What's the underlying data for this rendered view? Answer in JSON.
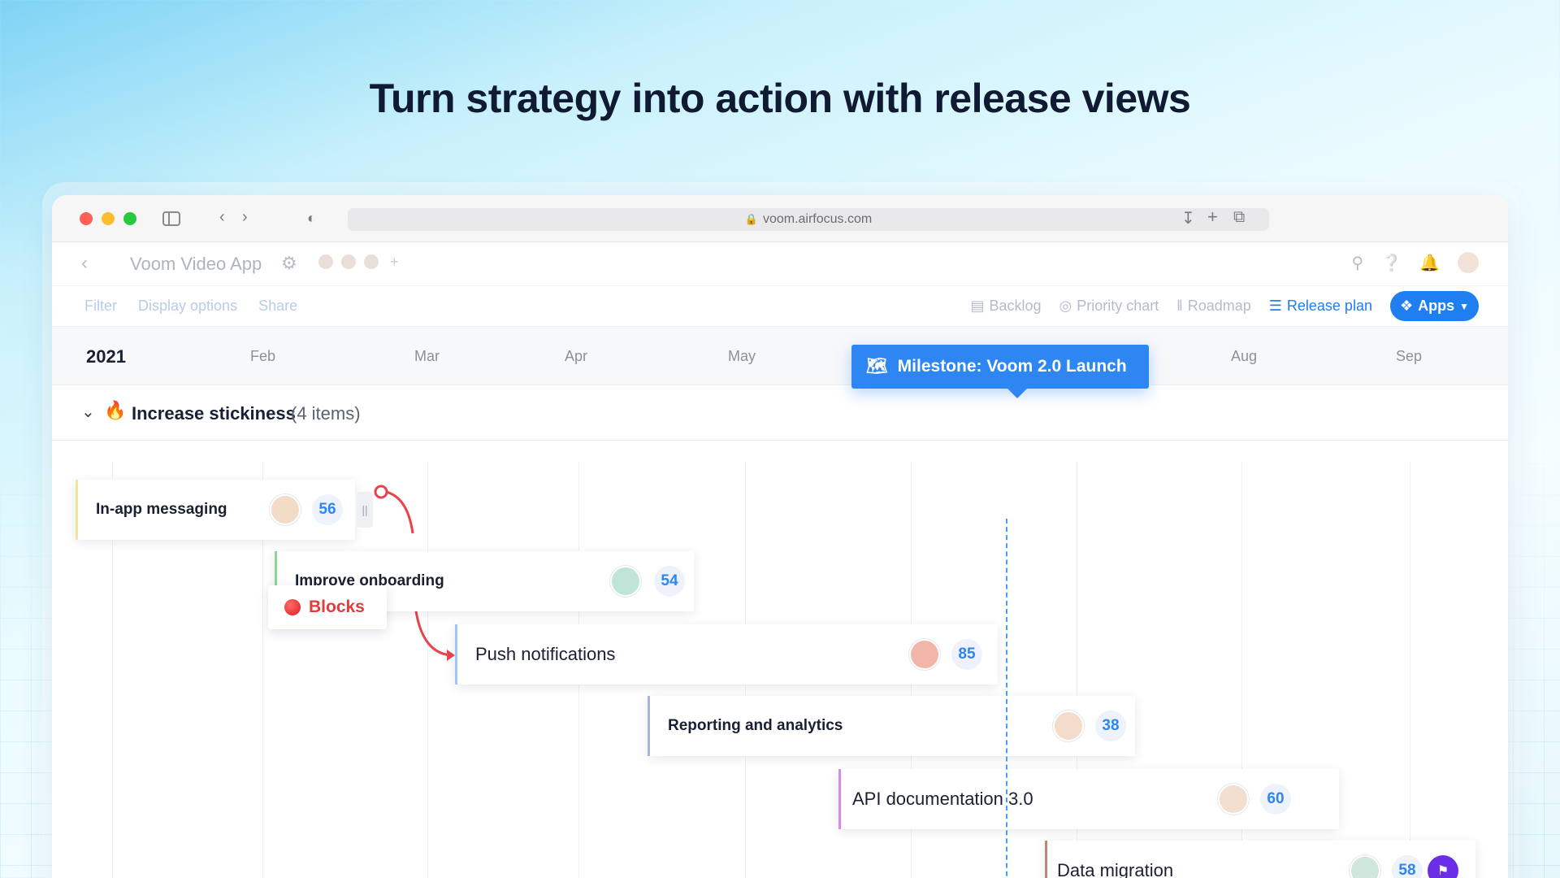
{
  "headline": "Turn strategy into action with release views",
  "browser": {
    "url": "voom.airfocus.com"
  },
  "app": {
    "workspace_title": "Voom Video App",
    "toolbar_left": [
      "Filter",
      "Display options",
      "Share"
    ],
    "views": [
      {
        "label": "Backlog",
        "icon": "backlog-icon",
        "active": false
      },
      {
        "label": "Priority chart",
        "icon": "priority-chart-icon",
        "active": false
      },
      {
        "label": "Roadmap",
        "icon": "roadmap-icon",
        "active": false
      },
      {
        "label": "Release plan",
        "icon": "release-plan-icon",
        "active": true
      }
    ],
    "apps_label": "Apps"
  },
  "timeline": {
    "year": "2021",
    "months": [
      "Feb",
      "Mar",
      "Apr",
      "May",
      "Aug",
      "Sep"
    ]
  },
  "group": {
    "title": "Increase stickiness",
    "count": "(4 items)"
  },
  "milestone": {
    "label": "Milestone: Voom 2.0 Launch"
  },
  "dependency": {
    "label": "Blocks"
  },
  "items": [
    {
      "title": "In-app messaging",
      "score": "56",
      "color": "#f2e3a1"
    },
    {
      "title": "Improve onboarding",
      "score": "54",
      "color": "#8fd29a"
    },
    {
      "title": "Push notifications",
      "score": "85",
      "color": "#9cc7f6"
    },
    {
      "title": "Reporting and analytics",
      "score": "38",
      "color": "#a8b4d8"
    },
    {
      "title": "API documentation 3.0",
      "score": "60",
      "color": "#d28fe0"
    },
    {
      "title": "Data migration",
      "score": "58",
      "color": "#b9897a"
    }
  ],
  "colors": {
    "accent": "#2d86f2",
    "blocks_red": "#e23c3c",
    "flag_purple": "#6a2ee6"
  }
}
